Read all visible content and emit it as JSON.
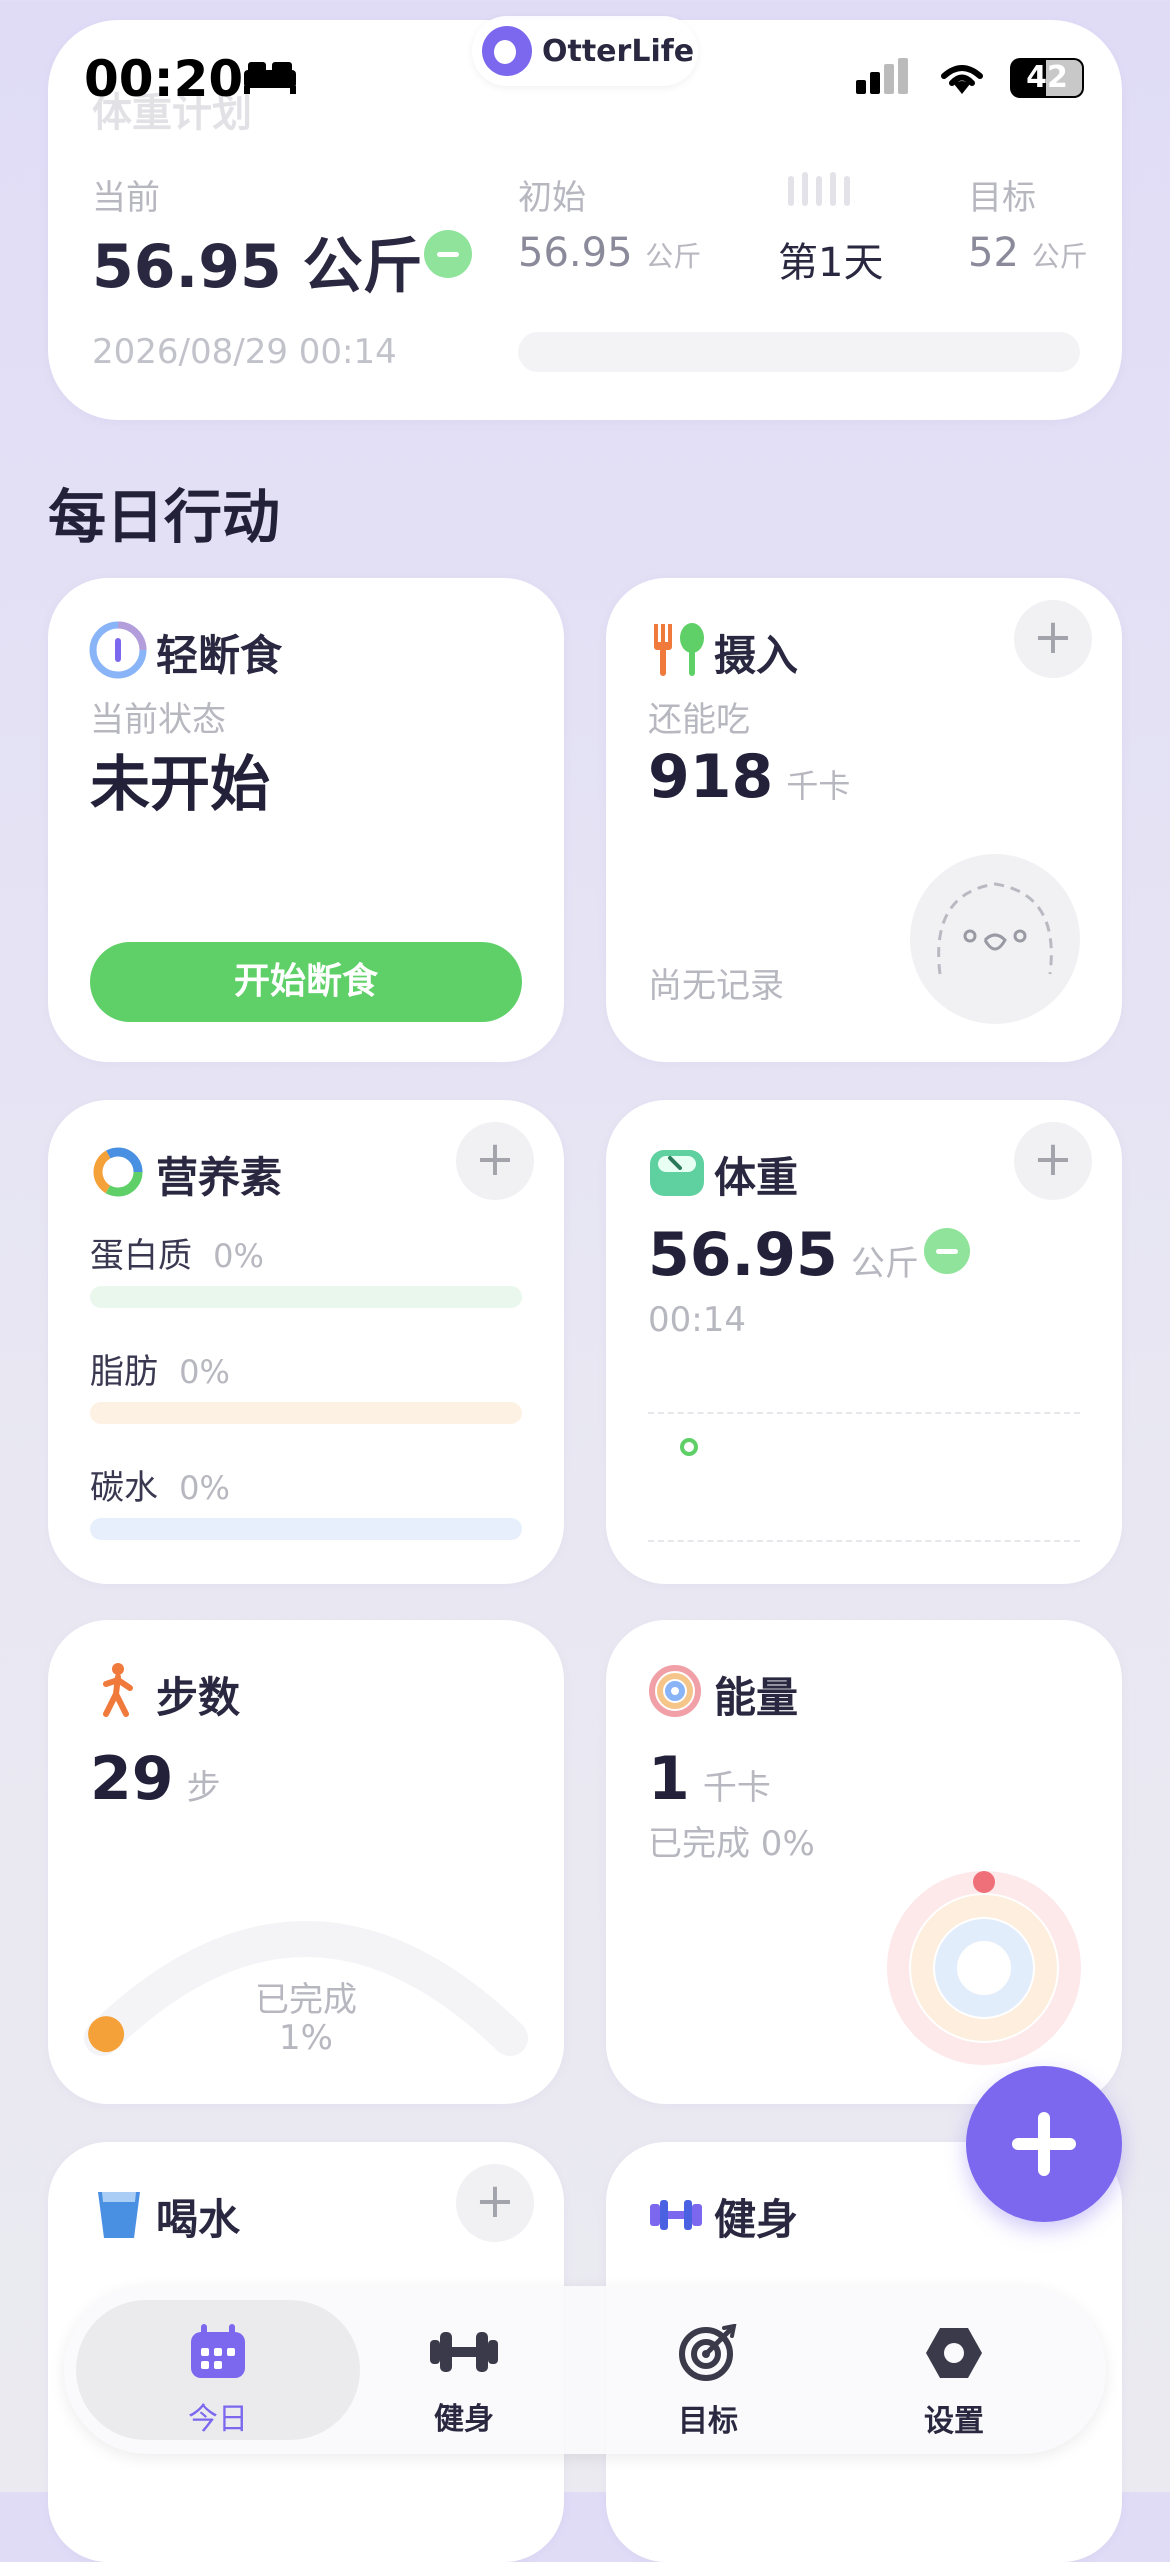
{
  "status_bar": {
    "time": "00:20",
    "app_badge": "OtterLife",
    "battery": "42"
  },
  "plan": {
    "title": "体重计划",
    "current_label": "当前",
    "current_value": "56.95 公斤",
    "initial_label": "初始",
    "initial_value": "56.95",
    "initial_unit": "公斤",
    "day_value": "第1天",
    "target_label": "目标",
    "target_value": "52",
    "target_unit": "公斤",
    "datetime": "2026/08/29 00:14"
  },
  "section_title": "每日行动",
  "fasting": {
    "title": "轻断食",
    "status_label": "当前状态",
    "status_value": "未开始",
    "button_label": "开始断食"
  },
  "intake": {
    "title": "摄入",
    "remain_label": "还能吃",
    "value": "918",
    "unit": "千卡",
    "empty_text": "尚无记录"
  },
  "nutrients": {
    "title": "营养素",
    "items": [
      {
        "name": "蛋白质",
        "percent": "0%",
        "color": "#eaf7ec"
      },
      {
        "name": "脂肪",
        "percent": "0%",
        "color": "#fdf1e3"
      },
      {
        "name": "碳水",
        "percent": "0%",
        "color": "#e6effb"
      }
    ]
  },
  "weight": {
    "title": "体重",
    "value": "56.95",
    "unit": "公斤",
    "time": "00:14"
  },
  "steps": {
    "title": "步数",
    "value": "29",
    "unit": "步",
    "done_label": "已完成",
    "done_percent": "1%",
    "progress": 0.01
  },
  "energy": {
    "title": "能量",
    "value": "1",
    "unit": "千卡",
    "done_text": "已完成 0%"
  },
  "water": {
    "title": "喝水"
  },
  "fitness": {
    "title": "健身"
  },
  "nav": {
    "items": [
      {
        "label": "今日",
        "icon": "calendar-icon",
        "active": true
      },
      {
        "label": "健身",
        "icon": "dumbbell-icon"
      },
      {
        "label": "目标",
        "icon": "target-icon"
      },
      {
        "label": "设置",
        "icon": "settings-hex-icon"
      }
    ]
  },
  "colors": {
    "accent": "#7b68ee",
    "green": "#5fd068",
    "orange": "#f5a13a"
  }
}
